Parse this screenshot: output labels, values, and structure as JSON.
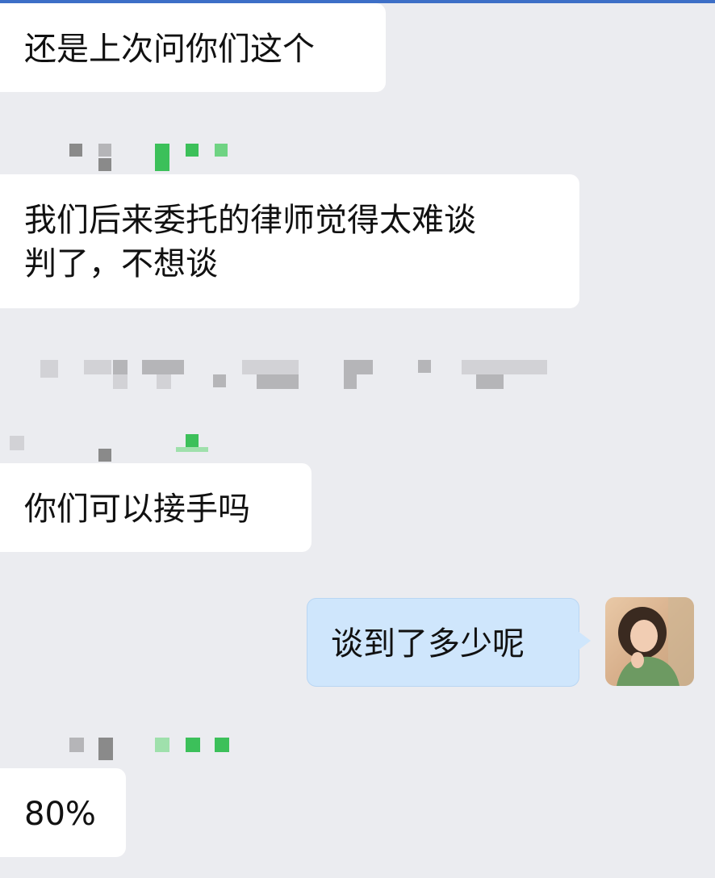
{
  "messages": [
    {
      "side": "incoming",
      "text": "还是上次问你们这个"
    },
    {
      "side": "incoming",
      "text": "我们后来委托的律师觉得太难谈\n判了，不想谈"
    },
    {
      "side": "incoming",
      "text": "你们可以接手吗"
    },
    {
      "side": "outgoing",
      "text": "谈到了多少呢"
    },
    {
      "side": "incoming",
      "text": "80%"
    }
  ],
  "colors": {
    "background": "#ebecf0",
    "incoming_bubble": "#ffffff",
    "outgoing_bubble": "#cfe6fc",
    "accent_strip": "#3d6fc7"
  },
  "icons": {
    "sender_name_redacted": "pixelated-name",
    "user_avatar": "avatar-photo"
  }
}
